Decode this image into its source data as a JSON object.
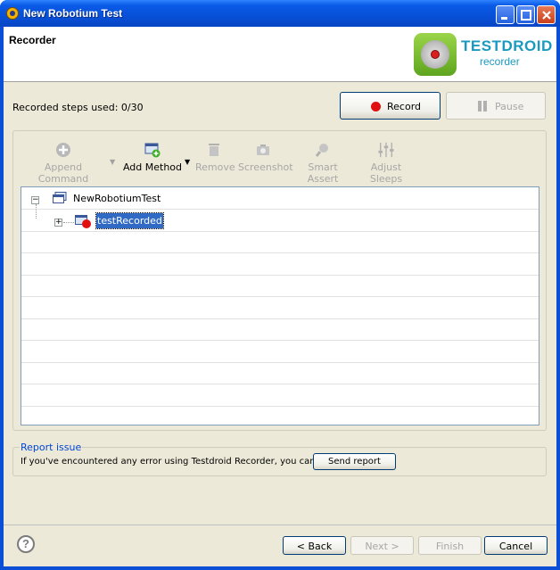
{
  "window": {
    "title": "New Robotium Test",
    "minimize_icon": "minimize-icon",
    "maximize_icon": "maximize-icon",
    "close_icon": "close-icon"
  },
  "header": {
    "title": "Recorder",
    "logo_text": "TESTDROID",
    "logo_sub": "recorder"
  },
  "status": {
    "steps_used": "Recorded steps used: 0/30"
  },
  "controls": {
    "record_label": "Record",
    "pause_label": "Pause"
  },
  "toolbar": [
    {
      "label": "Append Command",
      "icon": "plus-circle-icon",
      "enabled": false
    },
    {
      "label": "Add Method",
      "icon": "add-method-icon",
      "enabled": true
    },
    {
      "label": "Remove",
      "icon": "trash-icon",
      "enabled": false
    },
    {
      "label": "Screenshot",
      "icon": "camera-icon",
      "enabled": false
    },
    {
      "label": "Smart Assert",
      "icon": "assert-icon",
      "enabled": false
    },
    {
      "label": "Adjust Sleeps",
      "icon": "sliders-icon",
      "enabled": false
    }
  ],
  "tree": {
    "root": "NewRobotiumTest",
    "child": "testRecorded"
  },
  "report": {
    "title": "Report issue",
    "text": "If you've encountered any error using Testdroid Recorder, you can send us report.",
    "button": "Send report"
  },
  "footer": {
    "back": "< Back",
    "next": "Next >",
    "finish": "Finish",
    "cancel": "Cancel",
    "help": "?"
  },
  "colors": {
    "titlebar": "#0a5ae6",
    "selection": "#316ac5",
    "record": "#e01010",
    "logo": "#1a9ac0"
  }
}
